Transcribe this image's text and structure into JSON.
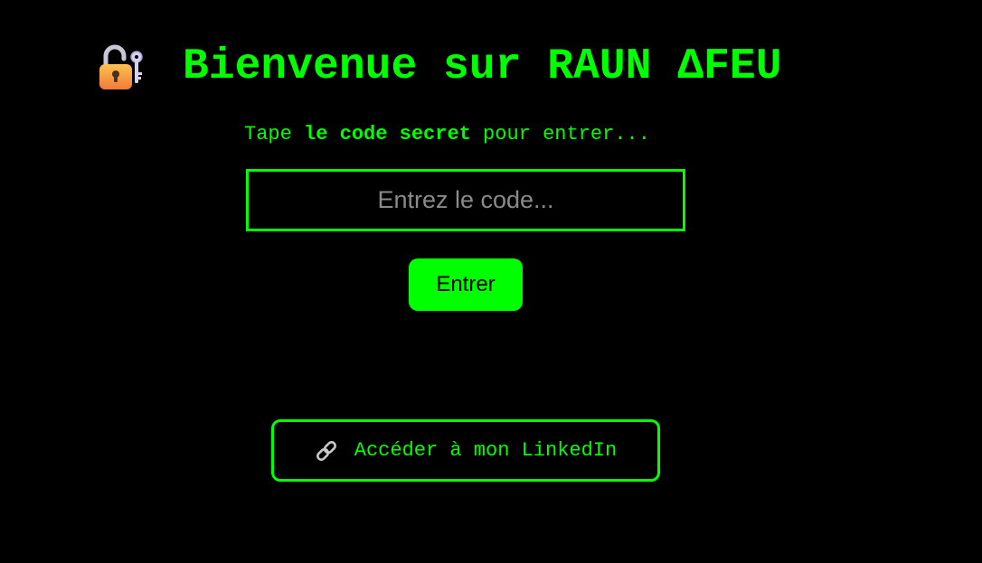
{
  "header": {
    "title": "Bienvenue sur RAUN ΔFEU",
    "lock_icon": "lock-with-key-icon"
  },
  "prompt": {
    "before": "Tape ",
    "bold": "le code secret",
    "after": " pour entrer..."
  },
  "code_input": {
    "value": "",
    "placeholder": "Entrez le code..."
  },
  "enter_button": {
    "label": "Entrer"
  },
  "linkedin": {
    "icon": "link-icon",
    "label": "Accéder à mon LinkedIn"
  },
  "colors": {
    "background": "#000000",
    "accent": "#00ff00",
    "placeholder": "#8a8a8a",
    "button_text": "#000000"
  }
}
